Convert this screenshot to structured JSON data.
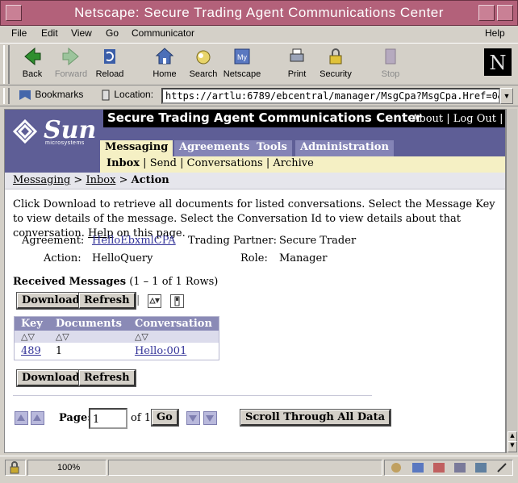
{
  "window": {
    "title": "Netscape: Secure Trading Agent Communications Center"
  },
  "menubar": {
    "items": [
      "File",
      "Edit",
      "View",
      "Go",
      "Communicator"
    ],
    "help": "Help"
  },
  "toolbar": {
    "back": "Back",
    "forward": "Forward",
    "reload": "Reload",
    "home": "Home",
    "search": "Search",
    "netscape": "Netscape",
    "print": "Print",
    "security": "Security",
    "stop": "Stop"
  },
  "location": {
    "bookmarks": "Bookmarks",
    "label": "Location:",
    "url": "https://artlu:6789/ebcentral/manager/MsgCpa?MsgCpa.Href=0&"
  },
  "brand": {
    "word": "Sun",
    "sub": "microsystems"
  },
  "app": {
    "title": "Secure Trading Agent Communications Center",
    "links": {
      "about": "About",
      "sep1": " | ",
      "logout": "Log Out",
      "sep2": " | ",
      "help": "He"
    }
  },
  "tabs": [
    "Messaging",
    "Agreements",
    "Tools",
    "Administration"
  ],
  "subnav": {
    "inbox": "Inbox",
    "send": "Send",
    "conversations": "Conversations",
    "archive": "Archive",
    "sep": " | "
  },
  "breadcrumb": {
    "messaging": "Messaging",
    "sep": " > ",
    "inbox": "Inbox",
    "current": "Action"
  },
  "intro": {
    "text1": "Click Download to retrieve all documents for listed conversations. Select the Message Key to view details of the message. Select the Conversation Id to view details about that conversation. ",
    "help": "Help",
    "text2": " on this page."
  },
  "details": {
    "agreement_label": "Agreement:",
    "agreement_value": "HelloEbxmlCPA",
    "partner_label": "Trading Partner:",
    "partner_value": "Secure Trader",
    "action_label": "Action:",
    "action_value": "HelloQuery",
    "role_label": "Role:",
    "role_value": "Manager"
  },
  "received": {
    "title": "Received Messages",
    "range": "(1 – 1 of 1 Rows)"
  },
  "buttons": {
    "download": "Download",
    "refresh": "Refresh",
    "scroll_all": "Scroll Through All Data"
  },
  "table": {
    "headers": [
      "Key",
      "Documents",
      "Conversation"
    ],
    "sort_glyph": "△▽",
    "rows": [
      {
        "key": "489",
        "documents": "1",
        "conversation": "Hello:001"
      }
    ]
  },
  "pager": {
    "label": "Page:",
    "page_value": "1",
    "of": "of 1",
    "go": "Go"
  },
  "status": {
    "zoom": "100%"
  },
  "colors": {
    "banner": "#5e5e96",
    "tab": "#8484b6",
    "tab_active": "#f5f0c4",
    "link": "#333399",
    "titlebar": "#b3617a"
  }
}
